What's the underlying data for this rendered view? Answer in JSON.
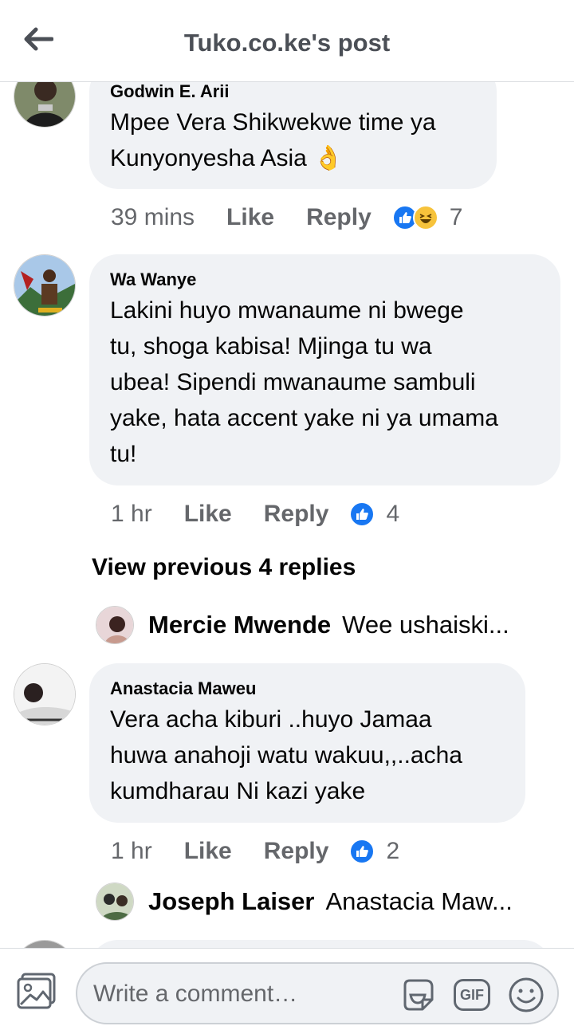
{
  "header": {
    "title": "Tuko.co.ke's post"
  },
  "comments": [
    {
      "author": "Godwin E. Arii",
      "lines": [
        "Mpee Vera Shikwekwe time ya",
        "Kunyonyesha Asia 👌"
      ],
      "time": "39 mins",
      "like_label": "Like",
      "reply_label": "Reply",
      "reactions": [
        "like-icon",
        "haha-icon"
      ],
      "reaction_count": "7"
    },
    {
      "author": "Wa Wanye",
      "lines": [
        "Lakini huyo mwanaume ni bwege",
        "tu, shoga kabisa! Mjinga tu wa",
        "ubea! Sipendi mwanaume sambuli",
        "yake, hata accent yake ni ya umama",
        "tu!"
      ],
      "time": "1 hr",
      "like_label": "Like",
      "reply_label": "Reply",
      "reactions": [
        "like-icon"
      ],
      "reaction_count": "4",
      "view_previous": "View previous 4 replies",
      "reply_preview": {
        "author": "Mercie Mwende",
        "text": "Wee ushaiski..."
      }
    },
    {
      "author": "Anastacia Maweu",
      "lines": [
        "Vera acha kiburi ..huyo Jamaa",
        "huwa anahoji watu wakuu,,..acha",
        "kumdharau Ni kazi yake"
      ],
      "time": "1 hr",
      "like_label": "Like",
      "reply_label": "Reply",
      "reactions": [
        "like-icon"
      ],
      "reaction_count": "2",
      "reply_preview": {
        "author": "Joseph Laiser",
        "text": "Anastacia Maw..."
      }
    }
  ],
  "composer": {
    "placeholder": "Write a comment…",
    "icons": [
      "photo-icon",
      "sticker-icon",
      "gif-icon",
      "emoji-icon"
    ],
    "gif_label": "GIF"
  },
  "colors": {
    "like_blue": "#1877f2",
    "bubble_gray": "#f0f2f5",
    "meta_gray": "#65676b"
  }
}
